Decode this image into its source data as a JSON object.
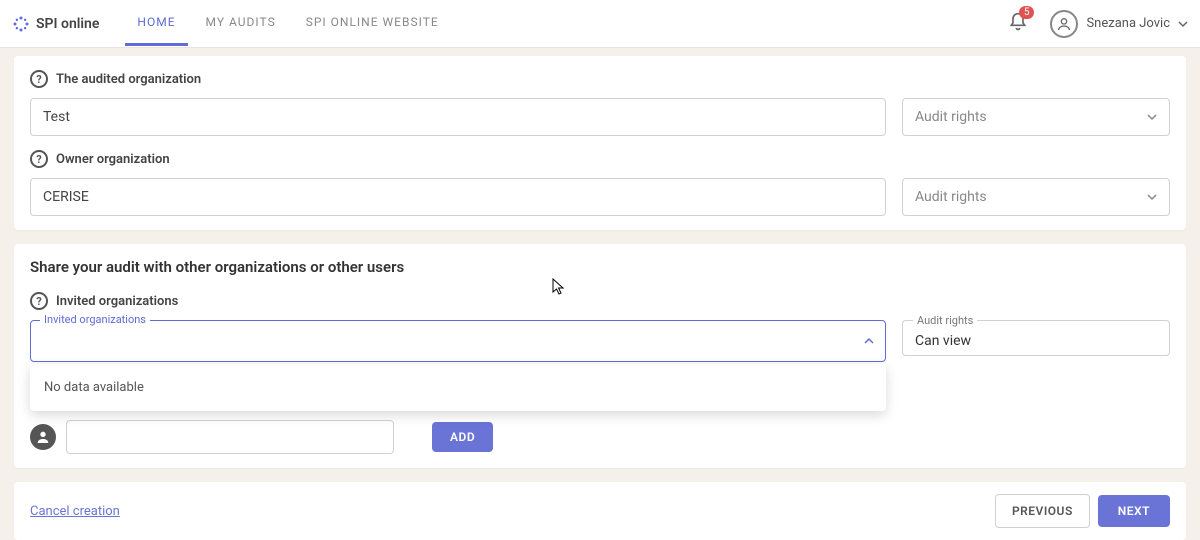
{
  "header": {
    "brand": "SPI online",
    "nav": [
      {
        "label": "HOME",
        "active": true
      },
      {
        "label": "MY AUDITS",
        "active": false
      },
      {
        "label": "SPI ONLINE WEBSITE",
        "active": false
      }
    ],
    "notification_count": "5",
    "user_name": "Snezana Jovic"
  },
  "org_section": {
    "audited_label": "The audited organization",
    "audited_value": "Test",
    "owner_label": "Owner organization",
    "owner_value": "CERISE",
    "rights_placeholder": "Audit rights"
  },
  "share_section": {
    "title": "Share your audit with other organizations or other users",
    "invited_label": "Invited organizations",
    "combo_label": "Invited organizations",
    "dropdown_empty": "No data available",
    "rights_label": "Audit rights",
    "rights_value": "Can view",
    "add_label": "ADD"
  },
  "footer": {
    "cancel": "Cancel creation",
    "previous": "PREVIOUS",
    "next": "NEXT"
  }
}
